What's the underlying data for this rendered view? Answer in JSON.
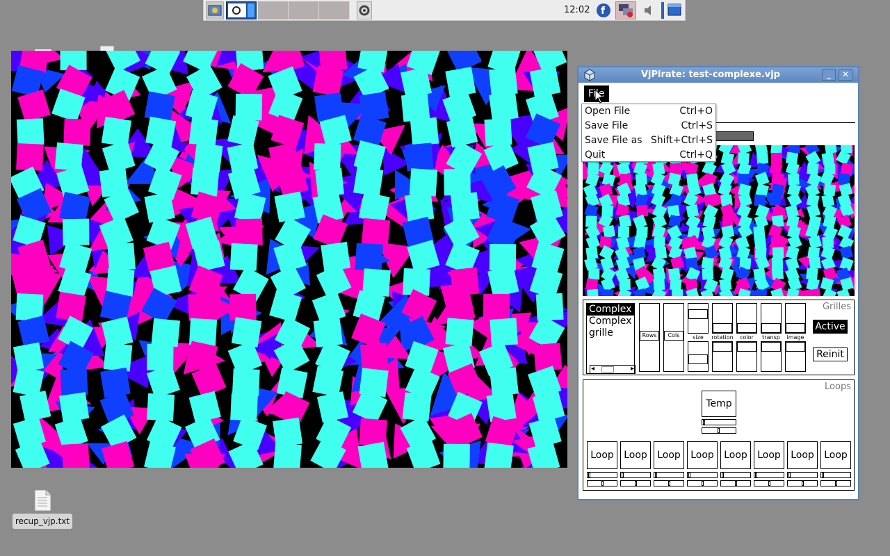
{
  "panel": {
    "clock": "12:02"
  },
  "desktop": {
    "file_label": "recup_vjp.txt"
  },
  "window": {
    "title": "VjPirate: test-complexe.vjp",
    "min_icon": "minimize-icon",
    "close_icon": "close-icon",
    "menu_file": "File"
  },
  "file_menu": [
    {
      "label": "Open File",
      "shortcut": "Ctrl+O"
    },
    {
      "label": "Save File",
      "shortcut": "Ctrl+S"
    },
    {
      "label": "Save File as",
      "shortcut": "Shift+Ctrl+S"
    },
    {
      "label": "Quit",
      "shortcut": "Ctrl+Q"
    }
  ],
  "grilles": {
    "title": "Grilles",
    "items": [
      "Complex",
      "Complex",
      "grille"
    ],
    "rows_label": "Rows",
    "cols_label": "Cols",
    "params": [
      "size",
      "rotation",
      "color",
      "transp",
      "image"
    ],
    "active_label": "Active",
    "reinit_label": "Reinit"
  },
  "loops": {
    "title": "Loops",
    "temp_label": "Temp",
    "loop_label": "Loop"
  },
  "colors": {
    "cyan": "#40ffee",
    "magenta": "#ff00c0",
    "blue": "#1040ff",
    "violet": "#4a00ff",
    "titlebar": "#5d87c0"
  }
}
